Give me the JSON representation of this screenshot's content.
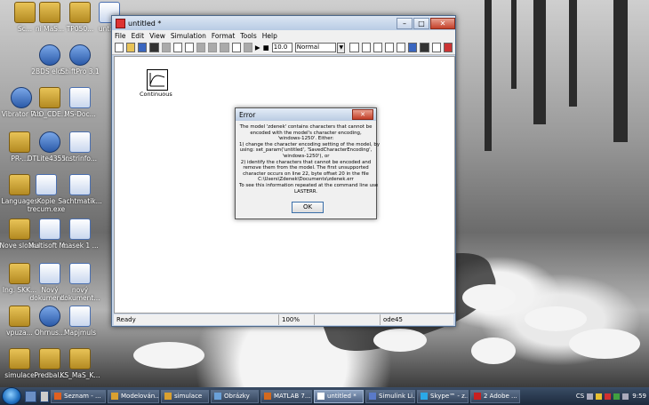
{
  "desktop": {
    "icons": [
      {
        "label": "Sc..."
      },
      {
        "label": "ni MaS..."
      },
      {
        "label": "TP050..."
      },
      {
        "label": "untit..."
      },
      {
        "label": "2BDS eld..."
      },
      {
        "label": "ShiftPro 3.1"
      },
      {
        "label": "Vibrator Pro"
      },
      {
        "label": "AIO_CDE..."
      },
      {
        "label": "MS-Doc..."
      },
      {
        "label": "PR-..."
      },
      {
        "label": "DTLite4355..."
      },
      {
        "label": "Instrinfo..."
      },
      {
        "label": "Languages"
      },
      {
        "label": "Kopie trecum.exe"
      },
      {
        "label": "Sachtmatik..."
      },
      {
        "label": "Nove slozka"
      },
      {
        "label": "Multisoft M..."
      },
      {
        "label": "masek 1 ..."
      },
      {
        "label": "Ing. SKK..."
      },
      {
        "label": "Nový dokument..."
      },
      {
        "label": "nový dokument..."
      },
      {
        "label": "vpuza..."
      },
      {
        "label": "Ohrnus..."
      },
      {
        "label": "Mapjmuls"
      },
      {
        "label": "simulace"
      },
      {
        "label": "Predbal..."
      },
      {
        "label": "KS_MaS_K..."
      }
    ]
  },
  "simulink": {
    "title": "untitled *",
    "menu": [
      "File",
      "Edit",
      "View",
      "Simulation",
      "Format",
      "Tools",
      "Help"
    ],
    "stop_time": "10.0",
    "sim_mode": "Normal",
    "block_label": "Continuous",
    "status": {
      "left": "Ready",
      "zoom": "100%",
      "blank": "",
      "solver": "ode45"
    }
  },
  "dialog": {
    "title": "Error",
    "lines": [
      "The model 'zdenek' contains characters that cannot be",
      "encoded with the model's character encoding,",
      "'windows-1250'. Either:",
      "1) change the character encoding setting of the model, by",
      "using: set_param('untitled', 'SavedCharacterEncoding',",
      "'windows-1250'), or",
      "2) identify the characters that cannot be encoded and",
      "remove them from the model. The first unsupported",
      "character occurs on line 22, byte offset 20 in the file",
      "C:\\Users\\Zdenek\\Documents\\zdenek.err",
      "To see this information repeated at the command line use",
      "LASTERR."
    ],
    "ok_label": "OK"
  },
  "taskbar": {
    "buttons": [
      {
        "label": "Seznam - ..."
      },
      {
        "label": "Modelován..."
      },
      {
        "label": "simulace"
      },
      {
        "label": "Obrázky"
      },
      {
        "label": "MATLAB 7...."
      },
      {
        "label": "untitled *"
      },
      {
        "label": "Simulink Li..."
      },
      {
        "label": "Skype™ - z..."
      },
      {
        "label": "2 Adobe ..."
      }
    ],
    "lang": "CS",
    "clock": "9:59"
  }
}
